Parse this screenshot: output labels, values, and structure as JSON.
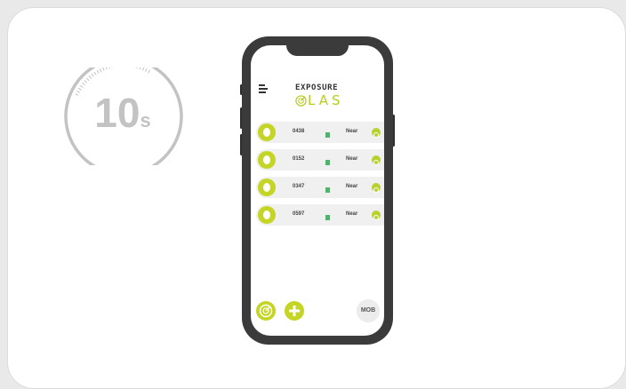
{
  "timer": {
    "value": "10",
    "unit": "s"
  },
  "app": {
    "brand_top": "EXPOSURE",
    "brand_bottom": "LAS",
    "devices": [
      {
        "id": "0438",
        "status": "Near"
      },
      {
        "id": "0152",
        "status": "Near"
      },
      {
        "id": "0347",
        "status": "Near"
      },
      {
        "id": "0597",
        "status": "Near"
      }
    ],
    "mob_label": "MOB"
  },
  "colors": {
    "accent": "#c5d526",
    "phone": "#3b3b3b",
    "timer": "#c3c3c3",
    "signal": "#55b070"
  },
  "icons": [
    "menu-icon",
    "radar-icon",
    "plus-icon",
    "check-icon",
    "tag-icon"
  ]
}
